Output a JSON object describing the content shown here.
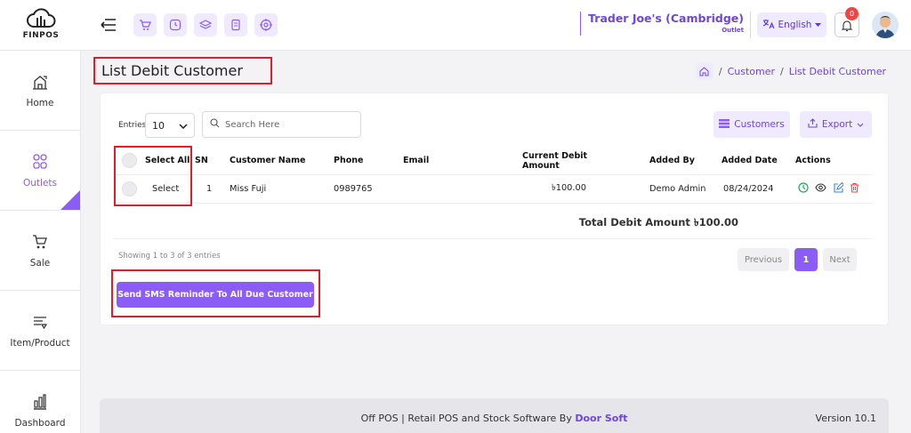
{
  "app": {
    "logo_text": "FINPOS"
  },
  "header": {
    "store_name": "Trader Joe's (Cambridge)",
    "store_type": "Outlet",
    "language": "English",
    "notifications_count": "0"
  },
  "sidebar": {
    "items": [
      {
        "label": "Home",
        "icon": "home-icon"
      },
      {
        "label": "Outlets",
        "icon": "outlets-icon",
        "active": true
      },
      {
        "label": "Sale",
        "icon": "cart-icon"
      },
      {
        "label": "Item/Product",
        "icon": "product-icon"
      },
      {
        "label": "Dashboard",
        "icon": "dashboard-icon"
      }
    ]
  },
  "page": {
    "title": "List Debit Customer",
    "breadcrumb": [
      "Customer",
      "List Debit Customer"
    ]
  },
  "controls": {
    "entries_label": "Entries",
    "entries_value": "10",
    "search_placeholder": "Search Here",
    "customers_button": "Customers",
    "export_button": "Export"
  },
  "table": {
    "headers": {
      "select_all": "Select All",
      "sn": "SN",
      "customer_name": "Customer Name",
      "phone": "Phone",
      "email": "Email",
      "current_debit_amount": "Current Debit Amount",
      "added_by": "Added By",
      "added_date": "Added Date",
      "actions": "Actions"
    },
    "rows": [
      {
        "select": "Select",
        "sn": "1",
        "customer_name": "Miss Fuji",
        "phone": "0989765",
        "email": "",
        "current_debit_amount": "৳100.00",
        "added_by": "Demo Admin",
        "added_date": "08/24/2024"
      }
    ],
    "total": "Total Debit Amount ৳100.00"
  },
  "pagination": {
    "showing": "Showing 1 to 3 of 3 entries",
    "previous": "Previous",
    "current": "1",
    "next": "Next"
  },
  "sms_button": "Send SMS Reminder To All Due Customer",
  "footer": {
    "text": "Off POS | Retail POS and Stock Software By ",
    "brand": "Door Soft",
    "version": "Version 10.1"
  },
  "colors": {
    "accent": "#8b5cf6",
    "accent_light": "#efeafd",
    "highlight": "#e11d2a"
  }
}
